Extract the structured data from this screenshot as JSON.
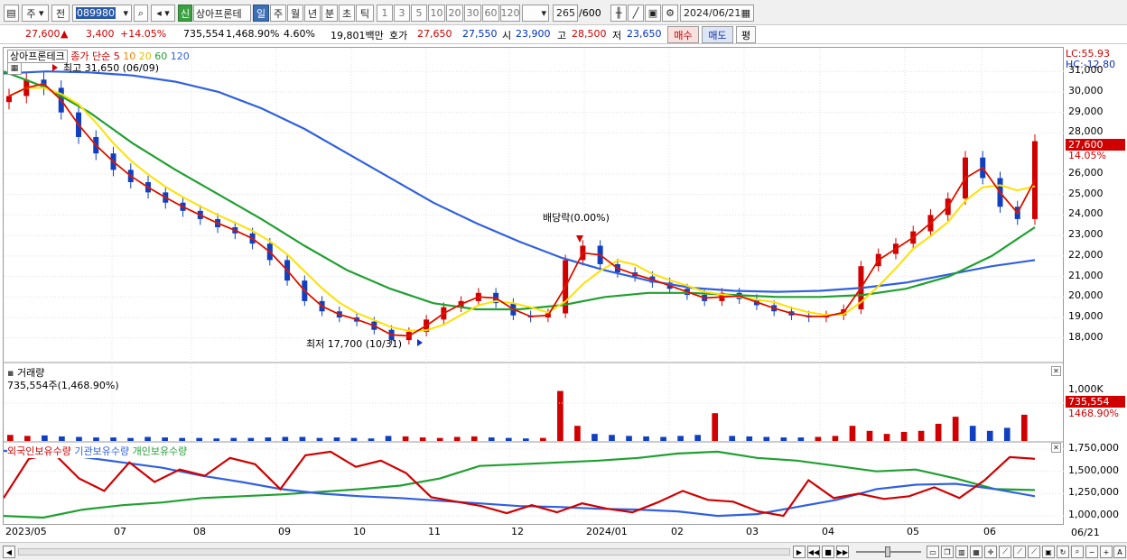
{
  "toolbar": {
    "market": "주",
    "period_label": "전",
    "code": "089980",
    "stock_name": "상아프론테",
    "badge": "신",
    "periods": [
      "일",
      "주",
      "월",
      "년",
      "분",
      "초",
      "틱"
    ],
    "intervals": [
      "1",
      "3",
      "5",
      "10",
      "20",
      "30",
      "60",
      "120"
    ],
    "count": "265",
    "count_max": "/600",
    "date": "2024/06/21"
  },
  "info": {
    "price": "27,600",
    "arrow": "▲",
    "change": "3,400",
    "change_pct": "+14.05%",
    "volume": "735,554",
    "volume_pct": "1,468.90%",
    "turnover": "4.60%",
    "amount": "19,801백만",
    "quote_label": "호가",
    "ask": "27,650",
    "bid": "27,550",
    "open_label": "시",
    "open": "23,900",
    "high_label": "고",
    "high": "28,500",
    "low_label": "저",
    "low": "23,650",
    "buy": "매수",
    "sell": "매도",
    "eval": "평"
  },
  "legend": {
    "name": "상아프론테크",
    "ma_label": "종가 단순",
    "ma": [
      "5",
      "10",
      "20",
      "60",
      "120"
    ],
    "max": "최고 31,650 (06/09)",
    "min": "최저 17,700 (10/31)",
    "dividend": "배당락(0.00%)",
    "lc": "LC:55.93",
    "hc": "HC:-12.80",
    "cur_price": "27,600",
    "cur_pct": "14.05%"
  },
  "volume_panel": {
    "title": "거래량",
    "value": "735,554주(1,468.90%)",
    "cur": "735,554",
    "cur_pct": "1468.90%",
    "tick": "1,000K"
  },
  "holder_panel": {
    "series": [
      "외국인보유수량",
      "기관보유수량",
      "개인보유수량"
    ]
  },
  "colors": {
    "candle_up": "#d00000",
    "candle_down": "#1040c0",
    "ma5": "#e00000",
    "ma10": "#f08000",
    "ma20": "#ffe000",
    "ma60": "#20a030",
    "ma120": "#3060e0"
  },
  "chart_data": {
    "type": "line",
    "x": [
      "2023/05",
      "07",
      "08",
      "09",
      "10",
      "11",
      "12",
      "2024/01",
      "02",
      "03",
      "04",
      "05",
      "06"
    ],
    "y_ticks": [
      "31,000",
      "30,000",
      "29,000",
      "28,000",
      "26,000",
      "25,000",
      "24,000",
      "23,000",
      "22,000",
      "21,000",
      "20,000",
      "19,000",
      "18,000"
    ],
    "holder_ticks": [
      "1,750,000",
      "1,500,000",
      "1,250,000",
      "1,000,000"
    ],
    "x_end": "06/21",
    "ylim": [
      17200,
      31800
    ],
    "close": [
      29800,
      30600,
      30200,
      29000,
      27800,
      27000,
      26200,
      25600,
      25100,
      24600,
      24200,
      23800,
      23400,
      23100,
      22600,
      21800,
      20800,
      19800,
      19300,
      19000,
      18800,
      18400,
      17900,
      18300,
      18900,
      19500,
      19800,
      20200,
      19700,
      19100,
      19000,
      19200,
      21800,
      22500,
      21600,
      21200,
      21000,
      20700,
      20400,
      20100,
      19800,
      20200,
      19900,
      19600,
      19300,
      19100,
      19000,
      19100,
      19400,
      21500,
      22100,
      22600,
      23200,
      24000,
      24800,
      26800,
      25800,
      24400,
      23800,
      27600
    ],
    "ma120": [
      30900,
      31000,
      30950,
      30800,
      30500,
      30000,
      29200,
      28200,
      27000,
      25800,
      24600,
      23600,
      22700,
      21900,
      21300,
      20800,
      20450,
      20300,
      20250,
      20300,
      20450,
      20700,
      21100,
      21500,
      21800
    ],
    "ma60": [
      31000,
      30200,
      29000,
      27500,
      26200,
      25000,
      23800,
      22500,
      21300,
      20400,
      19700,
      19400,
      19400,
      19600,
      20000,
      20200,
      20200,
      20100,
      20000,
      20000,
      20100,
      20400,
      21000,
      22000,
      23400
    ],
    "volume": [
      0.12,
      0.1,
      0.11,
      0.09,
      0.08,
      0.07,
      0.07,
      0.06,
      0.08,
      0.07,
      0.06,
      0.06,
      0.05,
      0.06,
      0.06,
      0.07,
      0.08,
      0.08,
      0.06,
      0.07,
      0.06,
      0.05,
      0.1,
      0.09,
      0.07,
      0.06,
      0.08,
      0.09,
      0.07,
      0.06,
      0.05,
      0.06,
      0.99,
      0.3,
      0.14,
      0.12,
      0.1,
      0.09,
      0.08,
      0.1,
      0.12,
      0.55,
      0.1,
      0.09,
      0.08,
      0.07,
      0.07,
      0.08,
      0.1,
      0.3,
      0.2,
      0.14,
      0.18,
      0.2,
      0.34,
      0.48,
      0.3,
      0.2,
      0.26,
      0.52
    ],
    "foreign": [
      1200000,
      1640000,
      1700000,
      1420000,
      1280000,
      1600000,
      1380000,
      1520000,
      1450000,
      1650000,
      1580000,
      1300000,
      1680000,
      1720000,
      1550000,
      1620000,
      1480000,
      1210000,
      1160000,
      1110000,
      1030000,
      1120000,
      1040000,
      1140000,
      1080000,
      1040000,
      1150000,
      1280000,
      1180000,
      1160000,
      1050000,
      1000000,
      1400000,
      1200000,
      1250000,
      1190000,
      1220000,
      1320000,
      1200000,
      1400000,
      1660000,
      1640000
    ],
    "institution": [
      1730000,
      1690000,
      1660000,
      1600000,
      1540000,
      1450000,
      1380000,
      1300000,
      1250000,
      1220000,
      1200000,
      1170000,
      1140000,
      1110000,
      1100000,
      1080000,
      1070000,
      1050000,
      1000000,
      1020000,
      1100000,
      1180000,
      1300000,
      1350000,
      1360000,
      1300000,
      1220000
    ],
    "individual": [
      1000000,
      980000,
      1070000,
      1120000,
      1150000,
      1200000,
      1220000,
      1240000,
      1270000,
      1300000,
      1340000,
      1420000,
      1560000,
      1580000,
      1600000,
      1620000,
      1650000,
      1700000,
      1720000,
      1650000,
      1620000,
      1560000,
      1500000,
      1520000,
      1420000,
      1300000,
      1290000
    ]
  }
}
